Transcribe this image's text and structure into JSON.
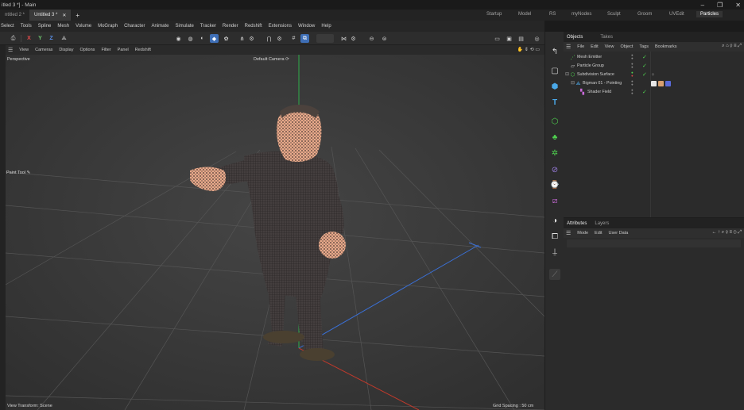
{
  "window": {
    "title": "itled 3 *] - Main",
    "controls": [
      "–",
      "❐",
      "✕"
    ]
  },
  "doc_tabs": [
    {
      "label": "ntitled 2 *",
      "active": false
    },
    {
      "label": "Untitled 3 *",
      "active": true,
      "close": "✕"
    }
  ],
  "new_tab": "+",
  "layouts": [
    {
      "label": "Startup",
      "active": false
    },
    {
      "label": "Model",
      "active": false
    },
    {
      "label": "RS",
      "active": false
    },
    {
      "label": "myNodes",
      "active": false
    },
    {
      "label": "Sculpt",
      "active": false
    },
    {
      "label": "Groom",
      "active": false
    },
    {
      "label": "UVEdit",
      "active": false
    },
    {
      "label": "Particles",
      "active": true
    }
  ],
  "menu": [
    "Select",
    "Tools",
    "Spline",
    "Mesh",
    "Volume",
    "MoGraph",
    "Character",
    "Animate",
    "Simulate",
    "Tracker",
    "Render",
    "Redshift",
    "Extensions",
    "Window",
    "Help"
  ],
  "toolbar": {
    "axis_x": "X",
    "axis_y": "Y",
    "axis_z": "Z"
  },
  "viewport_menu": [
    "View",
    "Cameras",
    "Display",
    "Options",
    "Filter",
    "Panel",
    "Redshift"
  ],
  "viewport": {
    "projection": "Perspective",
    "camera": "Default Camera",
    "camera_icon": "⟳",
    "tool": "Paint Tool",
    "tool_icon": "✎",
    "view_transform": "View Transform: Scene",
    "grid_spacing": "Grid Spacing : 50 cm"
  },
  "objects_panel": {
    "tabs": [
      {
        "label": "Objects",
        "active": true
      },
      {
        "label": "Takes",
        "active": false
      }
    ],
    "menu": [
      "File",
      "Edit",
      "View",
      "Object",
      "Tags",
      "Bookmarks"
    ],
    "items": [
      {
        "name": "Mesh Emitter",
        "icon": "emitter-icon",
        "indent": 0,
        "check": "✓"
      },
      {
        "name": "Particle Group",
        "icon": "folder-icon",
        "indent": 0,
        "check": "✓"
      },
      {
        "name": "Subdivision Surface",
        "icon": "subdivision-icon",
        "indent": 0,
        "check": "✓",
        "expand": "⊟"
      },
      {
        "name": "Bigman 01 - Pointing",
        "icon": "polygon-object-icon",
        "indent": 1,
        "check": "",
        "expand": "⊟"
      },
      {
        "name": "Shader Field",
        "icon": "shader-field-icon",
        "indent": 2,
        "check": "✓"
      }
    ]
  },
  "attributes_panel": {
    "tabs": [
      {
        "label": "Attributes",
        "active": true
      },
      {
        "label": "Layers",
        "active": false
      }
    ],
    "menu": [
      "Mode",
      "Edit",
      "User Data"
    ]
  },
  "colors": {
    "accent": "#3f6fb6",
    "viewport_bg": "#3c3c3c",
    "check_green": "#4fd14f",
    "axis_green": "#2fae4a",
    "axis_red": "#c0392b",
    "axis_blue": "#3a70d6"
  }
}
